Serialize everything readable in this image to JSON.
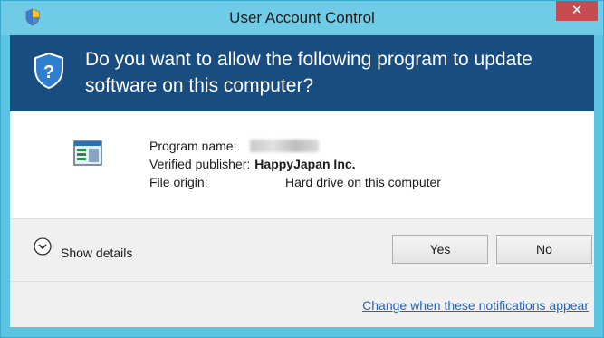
{
  "window": {
    "title": "User Account Control",
    "close_label": "✕"
  },
  "header": {
    "question": "Do you want to allow the following program to update software on this computer?"
  },
  "details": {
    "program_name_label": "Program name:",
    "publisher_label": "Verified publisher:",
    "publisher_value": "HappyJapan Inc.",
    "file_origin_label": "File origin:",
    "file_origin_value": "Hard drive on this computer"
  },
  "footer": {
    "show_details_label": "Show details",
    "yes_label": "Yes",
    "no_label": "No",
    "change_link_label": "Change when these notifications appear"
  },
  "colors": {
    "titlebar": "#6fcbe6",
    "header": "#1a4d7f",
    "close": "#c74c4f",
    "link": "#2464b8"
  },
  "icons": {
    "titlebar": "uac-shield-icon",
    "header": "uac-shield-question-icon",
    "program": "program-window-icon",
    "expand": "chevron-down-circle-icon"
  }
}
